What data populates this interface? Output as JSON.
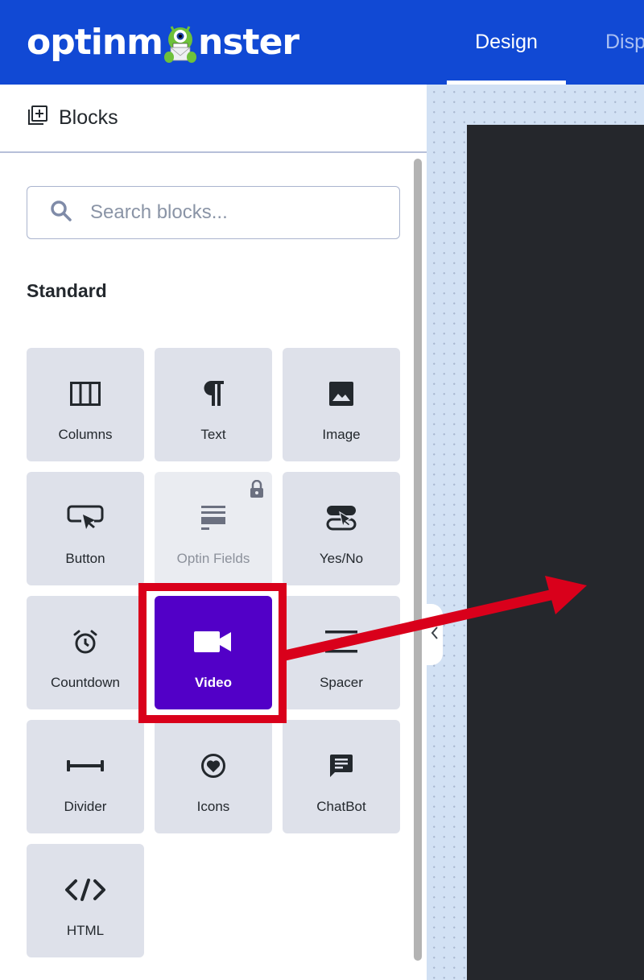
{
  "header": {
    "logo_text_left": "optinm",
    "logo_text_right": "nster",
    "tabs": [
      {
        "label": "Design",
        "active": true
      },
      {
        "label": "Disp",
        "active": false
      }
    ],
    "brand_color": "#1149d4"
  },
  "sidebar": {
    "panel_title": "Blocks",
    "search_placeholder": "Search blocks...",
    "search_value": "",
    "section_label": "Standard",
    "blocks": [
      {
        "label": "Columns",
        "icon": "columns-icon"
      },
      {
        "label": "Text",
        "icon": "paragraph-icon"
      },
      {
        "label": "Image",
        "icon": "image-icon"
      },
      {
        "label": "Button",
        "icon": "button-cursor-icon"
      },
      {
        "label": "Optin Fields",
        "icon": "optin-fields-icon",
        "locked": true
      },
      {
        "label": "Yes/No",
        "icon": "yes-no-toggle-icon"
      },
      {
        "label": "Countdown",
        "icon": "alarm-clock-icon"
      },
      {
        "label": "Video",
        "icon": "video-camera-icon",
        "highlighted": true
      },
      {
        "label": "Spacer",
        "icon": "spacer-icon"
      },
      {
        "label": "Divider",
        "icon": "divider-icon"
      },
      {
        "label": "Icons",
        "icon": "heart-circle-icon"
      },
      {
        "label": "ChatBot",
        "icon": "chat-bubble-icon"
      },
      {
        "label": "HTML",
        "icon": "code-icon"
      }
    ]
  },
  "annotation": {
    "highlight_color": "#d9001b",
    "active_block_color": "#5200c7"
  }
}
